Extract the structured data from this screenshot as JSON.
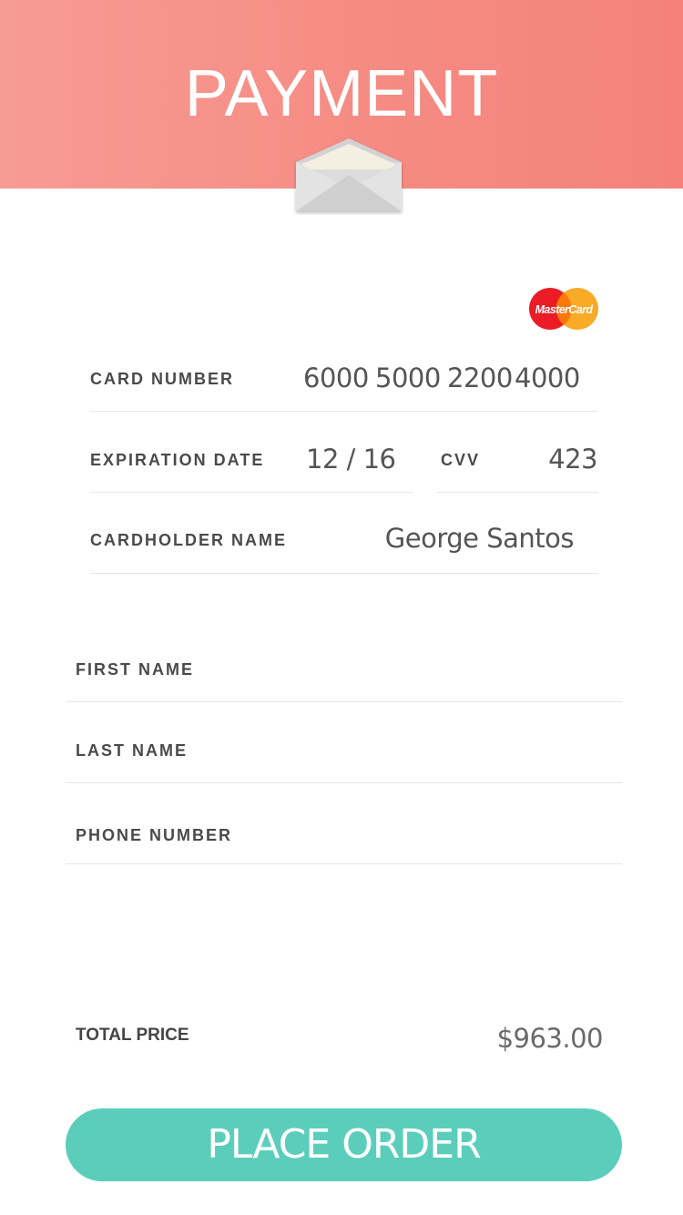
{
  "header": {
    "title": "PAYMENT"
  },
  "card": {
    "brand": "MasterCard",
    "number_label": "CARD NUMBER",
    "number_groups": [
      "6000",
      "5000",
      "2200",
      "4000"
    ],
    "expiration_label": "EXPIRATION DATE",
    "expiration_value": "12 / 16",
    "cvv_label": "CVV",
    "cvv_value": "423",
    "holder_label": "CARDHOLDER NAME",
    "holder_value": "George Santos"
  },
  "contact": {
    "first_name_label": "FIRST NAME",
    "last_name_label": "LAST NAME",
    "phone_label": "PHONE NUMBER"
  },
  "total": {
    "label": "TOTAL PRICE",
    "value": "$963.00"
  },
  "actions": {
    "place_order": "PLACE ORDER"
  },
  "colors": {
    "header_gradient_start": "#f79c93",
    "header_gradient_end": "#f4827a",
    "button": "#5bcebb",
    "label": "#4a4a4a"
  },
  "icons": {
    "envelope": "envelope-icon",
    "card_brand": "mastercard-logo"
  }
}
